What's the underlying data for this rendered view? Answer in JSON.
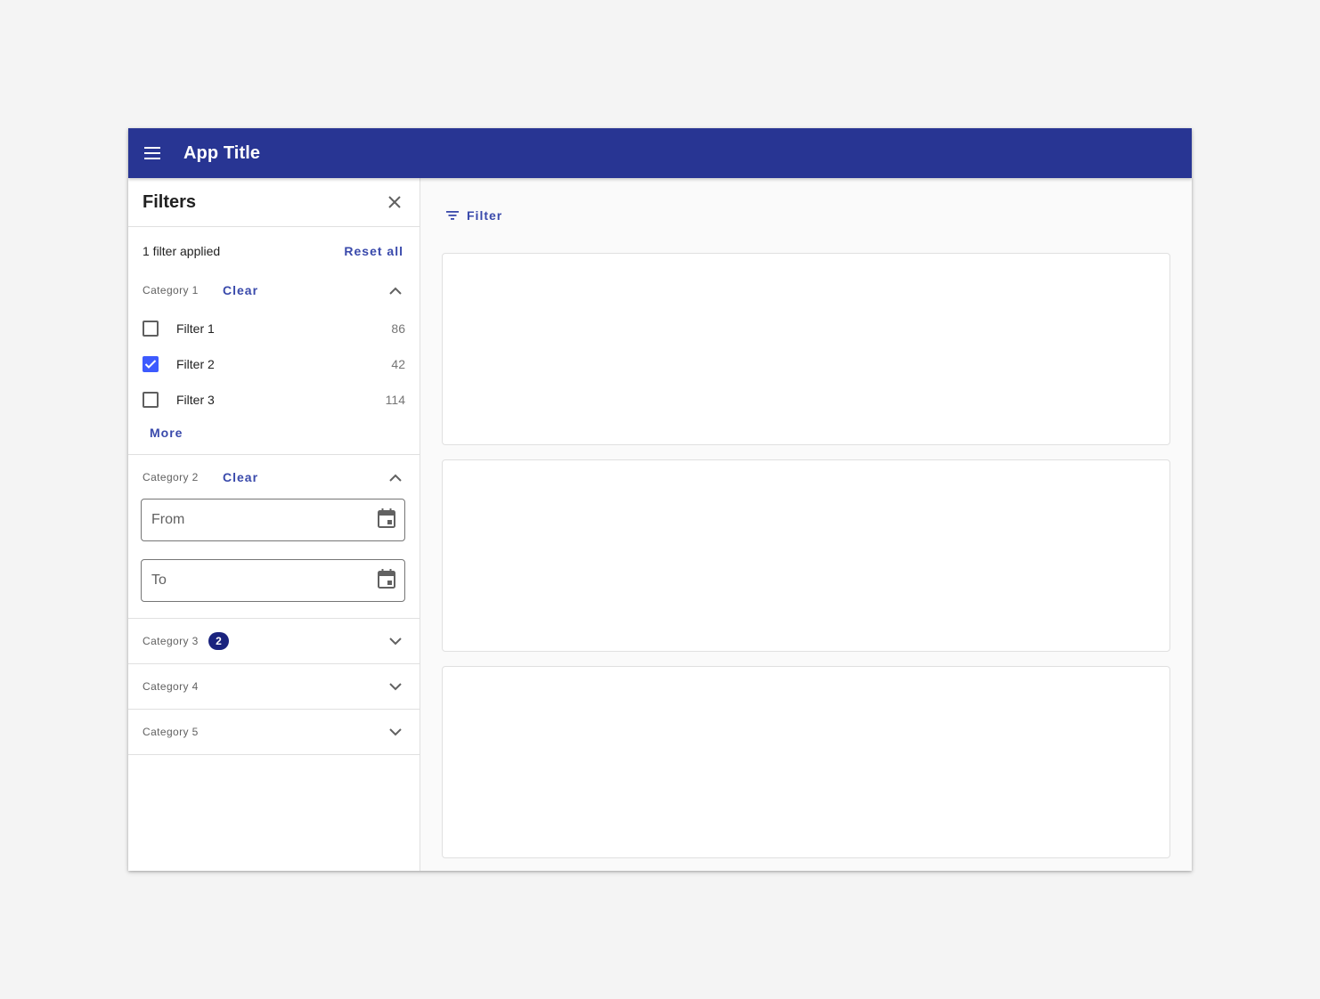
{
  "app": {
    "title": "App Title"
  },
  "filters_panel": {
    "title": "Filters",
    "applied_text": "1 filter applied",
    "reset_label": "Reset all",
    "categories": [
      {
        "label": "Category 1",
        "clear_label": "Clear",
        "expanded": true,
        "options": [
          {
            "label": "Filter 1",
            "count": "86",
            "checked": false
          },
          {
            "label": "Filter 2",
            "count": "42",
            "checked": true
          },
          {
            "label": "Filter 3",
            "count": "114",
            "checked": false
          }
        ],
        "more_label": "More"
      },
      {
        "label": "Category 2",
        "clear_label": "Clear",
        "expanded": true,
        "from_placeholder": "From",
        "to_placeholder": "To"
      },
      {
        "label": "Category 3",
        "badge": "2",
        "expanded": false
      },
      {
        "label": "Category 4",
        "expanded": false
      },
      {
        "label": "Category 5",
        "expanded": false
      }
    ]
  },
  "main": {
    "filter_button_label": "Filter",
    "cards_count": 3
  },
  "colors": {
    "app_bar": "#283593",
    "accent": "#3949ab",
    "checkbox_checked": "#3d5afe",
    "badge": "#1a237e"
  },
  "icons": {
    "menu": "menu-icon",
    "close": "close-icon",
    "filter": "filter-list-icon",
    "calendar": "calendar-icon",
    "expand_less": "chevron-up-icon",
    "expand_more": "chevron-down-icon"
  }
}
